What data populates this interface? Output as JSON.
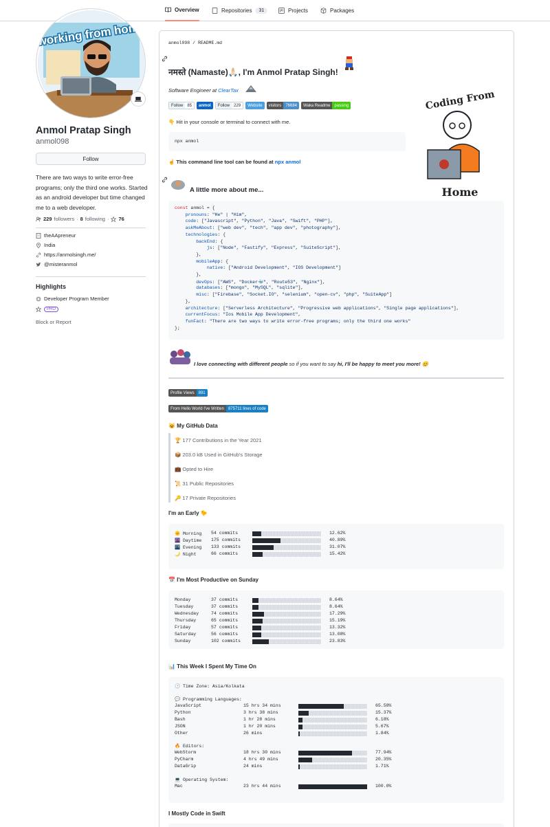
{
  "tabs": [
    {
      "label": "Overview",
      "count": ""
    },
    {
      "label": "Repositories",
      "count": "31"
    },
    {
      "label": "Projects",
      "count": ""
    },
    {
      "label": "Packages",
      "count": ""
    }
  ],
  "profile": {
    "avatar_text": "working from home",
    "name": "Anmol Pratap Singh",
    "login": "anmol098",
    "follow_label": "Follow",
    "bio": "There are two ways to write error-free programs; only the third one works. Started as an android developer but time changed me to a web developer.",
    "followers_count": "229",
    "followers_label": "followers",
    "following_count": "8",
    "following_label": "following",
    "stars_count": "76",
    "company": "theAApreneur",
    "location": "India",
    "website": "https://anmolsingh.me/",
    "twitter": "@misteranmol",
    "highlights_title": "Highlights",
    "highlight_program": "Developer Program Member",
    "highlight_pro": "PRO",
    "block_label": "Block or Report"
  },
  "readme": {
    "path_user": "anmol098",
    "path_sep": "/",
    "path_file": "README.md",
    "greeting": "नमस्ते (Namaste)🙏🏻, I'm Anmol Pratap Singh!",
    "role_prefix": "Software Engineer at",
    "role_company": "ClearTax",
    "badges": {
      "twitter_label": "Follow",
      "twitter_count": "85",
      "linkedin_label": "anmol",
      "github_label": "Follow",
      "github_count": "229",
      "website_label": "Website",
      "visitors_label": "visitors",
      "visitors_count": "76684",
      "waka_label": "Waka Readme",
      "waka_status": "passing"
    },
    "illustration_top": "Coding From",
    "illustration_bottom": "Home",
    "hit_text": "👇 Hit in your console or terminal to connect with me.",
    "npx_cmd": "npx anmol",
    "cli_text": "☝️ This command line tool can be found at",
    "cli_link": "npx anmol",
    "more_title": "A little more about me...",
    "code_lines": [
      "const anmol = {",
      "    pronouns: \"He\" | \"Him\",",
      "    code: [\"Javascript\", \"Python\", \"Java\", \"Swift\", \"PHP\"],",
      "    askMeAbout: [\"web dev\", \"tech\", \"app dev\", \"photography\"],",
      "    technologies: {",
      "        backEnd: {",
      "            js: [\"Node\", \"Fastify\", \"Express\", \"SuiteScript\"],",
      "        },",
      "        mobileApp: {",
      "            native: [\"Android Development\", \"IOS Development\"]",
      "        },",
      "        devOps: [\"AWS\", \"Docker🐳\", \"Route53\", \"Nginx\"],",
      "        databases: [\"mongo\", \"MySQL\", \"sqlite\"],",
      "        misc: [\"Firebase\", \"Socket.IO\", \"selenium\", \"open-cv\", \"php\", \"SuiteApp\"]",
      "    },",
      "    architecture: [\"Serverless Architecture\", \"Progressive web applications\", \"Single page applications\"],",
      "    currentFocus: \"Ios Mobile App Development\",",
      "    funFact: \"There are two ways to write error-free programs; only the third one works\"",
      "};"
    ],
    "connect_bold": "I love connecting with different people",
    "connect_mid": "so if you want to say",
    "connect_end": "hi, I'll be happy to meet you more! 😊",
    "profile_views_label": "Profile Views",
    "profile_views_count": "891",
    "loc_label": "From Hello World I've Written",
    "loc_count": "875711 lines of code",
    "github_data_title": "😺 My GitHub Data",
    "github_data": [
      "🏆 177 Contributions in the Year 2021",
      "📦 203.0 kB Used in GitHub's Storage",
      "💼 Opted to Hire",
      "📜 31 Public Repositories",
      "🔑 17 Private Repositories"
    ],
    "early_title": "I'm an Early 🐤",
    "early_rows": [
      {
        "name": "🌞 Morning",
        "amount": "54 commits",
        "pct": "12.62%",
        "fraction": 0.1262
      },
      {
        "name": "🌆 Daytime",
        "amount": "175 commits",
        "pct": "40.89%",
        "fraction": 0.4089
      },
      {
        "name": "🌃 Evening",
        "amount": "133 commits",
        "pct": "31.07%",
        "fraction": 0.3107
      },
      {
        "name": "🌙 Night",
        "amount": "66 commits",
        "pct": "15.42%",
        "fraction": 0.1542
      }
    ],
    "productive_title": "📅 I'm Most Productive on Sunday",
    "day_rows": [
      {
        "name": "Monday",
        "amount": "37 commits",
        "pct": "8.64%",
        "fraction": 0.0864
      },
      {
        "name": "Tuesday",
        "amount": "37 commits",
        "pct": "8.64%",
        "fraction": 0.0864
      },
      {
        "name": "Wednesday",
        "amount": "74 commits",
        "pct": "17.29%",
        "fraction": 0.1729
      },
      {
        "name": "Thursday",
        "amount": "65 commits",
        "pct": "15.19%",
        "fraction": 0.1519
      },
      {
        "name": "Friday",
        "amount": "57 commits",
        "pct": "13.32%",
        "fraction": 0.1332
      },
      {
        "name": "Saturday",
        "amount": "56 commits",
        "pct": "13.08%",
        "fraction": 0.1308
      },
      {
        "name": "Sunday",
        "amount": "102 commits",
        "pct": "23.83%",
        "fraction": 0.2383
      }
    ],
    "week_title": "📊 This Week I Spent My Time On",
    "timezone": "🕑 Time Zone: Asia/Kolkata",
    "lang_header": "💬 Programming Languages:",
    "lang_rows": [
      {
        "name": "JavaScript",
        "amount": "15 hrs 34 mins",
        "pct": "65.58%",
        "fraction": 0.6558
      },
      {
        "name": "Python",
        "amount": "3 hrs 38 mins",
        "pct": "15.37%",
        "fraction": 0.1537
      },
      {
        "name": "Bash",
        "amount": "1 hr 28 mins",
        "pct": "6.18%",
        "fraction": 0.0618
      },
      {
        "name": "JSON",
        "amount": "1 hr 20 mins",
        "pct": "5.67%",
        "fraction": 0.0567
      },
      {
        "name": "Other",
        "amount": "26 mins",
        "pct": "1.84%",
        "fraction": 0.0184
      }
    ],
    "editor_header": "🔥 Editors:",
    "editor_rows": [
      {
        "name": "WebStorm",
        "amount": "18 hrs 30 mins",
        "pct": "77.94%",
        "fraction": 0.7794
      },
      {
        "name": "PyCharm",
        "amount": "4 hrs 49 mins",
        "pct": "20.35%",
        "fraction": 0.2035
      },
      {
        "name": "DataGrip",
        "amount": "24 mins",
        "pct": "1.71%",
        "fraction": 0.0171
      }
    ],
    "os_header": "💻 Operating System:",
    "os_rows": [
      {
        "name": "Mac",
        "amount": "23 hrs 44 mins",
        "pct": "100.0%",
        "fraction": 1.0
      }
    ],
    "swift_title": "I Mostly Code in Swift"
  }
}
